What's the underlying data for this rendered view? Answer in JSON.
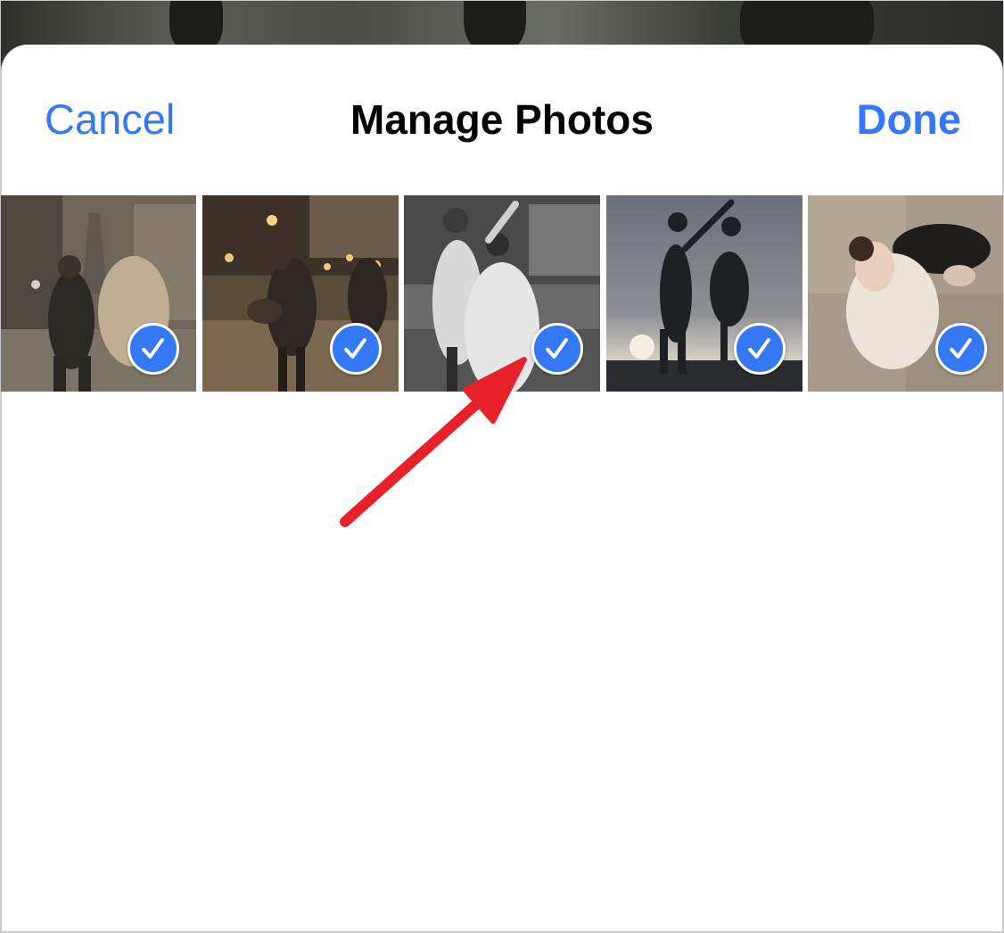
{
  "nav": {
    "cancel_label": "Cancel",
    "title": "Manage Photos",
    "done_label": "Done"
  },
  "photos": [
    {
      "selected": true,
      "icon": "checkmark-icon"
    },
    {
      "selected": true,
      "icon": "checkmark-icon"
    },
    {
      "selected": true,
      "icon": "checkmark-icon"
    },
    {
      "selected": true,
      "icon": "checkmark-icon"
    },
    {
      "selected": true,
      "icon": "checkmark-icon"
    }
  ],
  "colors": {
    "accent": "#3478f6",
    "annotation_arrow": "#e8202a",
    "title_text": "#000000"
  }
}
